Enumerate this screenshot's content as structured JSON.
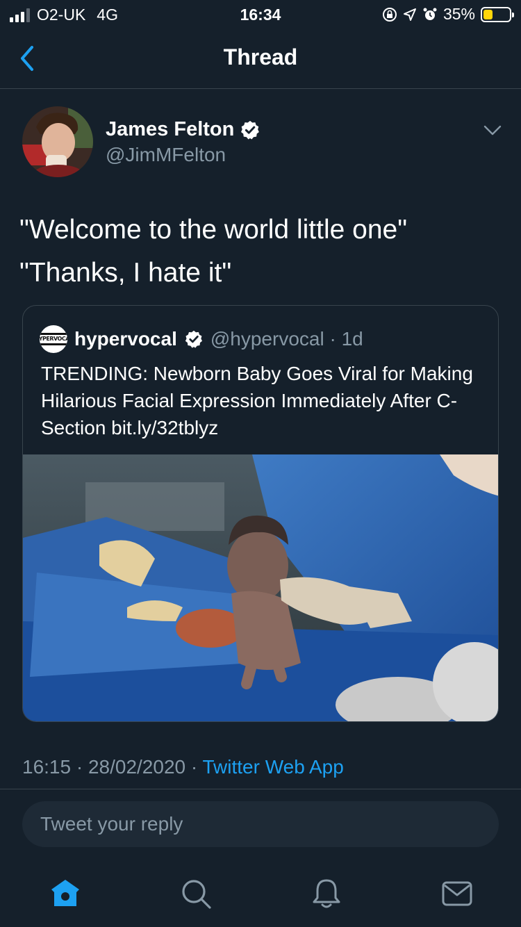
{
  "status_bar": {
    "carrier": "O2-UK",
    "network": "4G",
    "time": "16:34",
    "battery_percent": "35%",
    "battery_level": 0.35,
    "battery_color": "#ffd60a"
  },
  "nav": {
    "title": "Thread",
    "back_icon": "chevron-left-icon"
  },
  "tweet": {
    "author_name": "James Felton",
    "author_handle": "@JimMFelton",
    "verified": true,
    "text_lines": [
      "\"Welcome to the world little one\"",
      "\"Thanks, I hate it\""
    ],
    "timestamp": "16:15 · 28/02/2020 · ",
    "source": "Twitter Web App"
  },
  "quote": {
    "name": "hypervocal",
    "avatar_text": "HYPERVOCAL",
    "handle_time": "@hypervocal · 1d",
    "text": "TRENDING: Newborn Baby Goes Viral for Making Hilarious Facial Expression Immediately After C-Section bit.ly/32tblyz"
  },
  "reply": {
    "placeholder": "Tweet your reply"
  },
  "tabbar": {
    "items": [
      "home-icon",
      "search-icon",
      "notifications-bell-icon",
      "messages-envelope-icon"
    ]
  },
  "colors": {
    "background": "#15202b",
    "accent": "#1da1f2",
    "secondary_text": "#8899a6",
    "border": "#38444d"
  }
}
